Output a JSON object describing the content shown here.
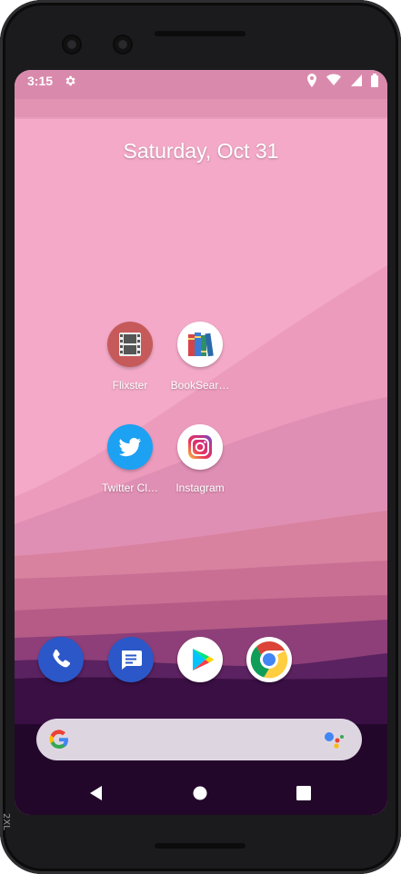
{
  "status_bar": {
    "time": "3:15",
    "icons": [
      "settings-icon",
      "location-icon",
      "wifi-icon",
      "cell-signal-icon",
      "battery-icon"
    ]
  },
  "home": {
    "date": "Saturday, Oct 31",
    "apps": [
      {
        "label": "Flixster",
        "icon": "film-icon",
        "color": "#c65a5a"
      },
      {
        "label": "BookSear…",
        "icon": "books-icon",
        "color": "#ffffff"
      },
      {
        "label": "Twitter Cl…",
        "icon": "twitter-bird-icon",
        "color": "#1da1f2"
      },
      {
        "label": "Instagram",
        "icon": "instagram-icon",
        "color": "#ffffff"
      }
    ]
  },
  "dock": {
    "apps": [
      {
        "name": "Phone",
        "icon": "phone-icon",
        "color": "#2b57c8"
      },
      {
        "name": "Messages",
        "icon": "messages-icon",
        "color": "#2b57c8"
      },
      {
        "name": "Play Store",
        "icon": "play-store-icon",
        "color": "#ffffff"
      },
      {
        "name": "Chrome",
        "icon": "chrome-icon",
        "color": "#ffffff"
      }
    ]
  },
  "search_bar": {
    "icons": [
      "google-g-icon",
      "google-assistant-icon"
    ]
  },
  "nav_bar": {
    "buttons": [
      "back-button",
      "home-button",
      "recents-button"
    ]
  },
  "device": {
    "side_label": "2XL"
  }
}
